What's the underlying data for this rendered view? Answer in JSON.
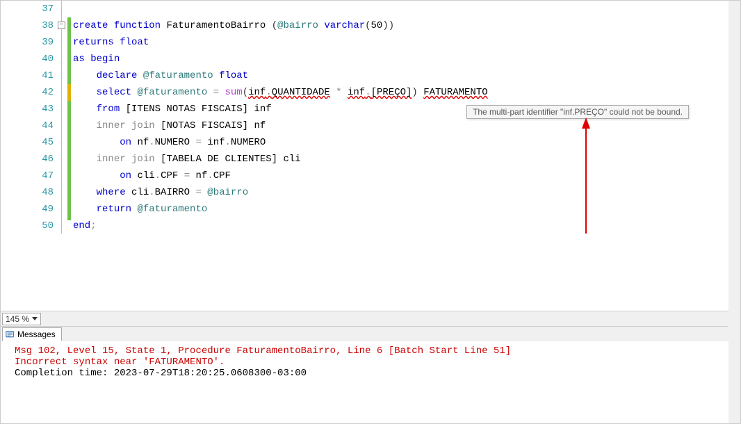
{
  "line_numbers": [
    "37",
    "38",
    "39",
    "40",
    "41",
    "42",
    "43",
    "44",
    "45",
    "46",
    "47",
    "48",
    "49",
    "50"
  ],
  "code": {
    "l38": {
      "w0": "create",
      "w1": "function",
      "w2": "FaturamentoBairro",
      "w3": "@bairro",
      "w4": "varchar",
      "w5": "50"
    },
    "l39": {
      "w0": "returns",
      "w1": "float"
    },
    "l40": {
      "w0": "as",
      "w1": "begin"
    },
    "l41": {
      "w0": "declare",
      "w1": "@faturamento",
      "w2": "float"
    },
    "l42": {
      "w0": "select",
      "w1": "@faturamento",
      "w2": "=",
      "w3": "sum",
      "w4": "inf",
      "w5": "QUANTIDADE",
      "w6": "*",
      "w7": "inf",
      "w8": "[PREÇO]",
      "w9": "FATURAMENTO"
    },
    "l43": {
      "w0": "from",
      "w1": "[ITENS NOTAS FISCAIS]",
      "w2": "inf"
    },
    "l44": {
      "w0": "inner",
      "w1": "join",
      "w2": "[NOTAS FISCAIS]",
      "w3": "nf"
    },
    "l45": {
      "w0": "on",
      "w1": "nf",
      "w2": "NUMERO",
      "w3": "=",
      "w4": "inf",
      "w5": "NUMERO"
    },
    "l46": {
      "w0": "inner",
      "w1": "join",
      "w2": "[TABELA DE CLIENTES]",
      "w3": "cli"
    },
    "l47": {
      "w0": "on",
      "w1": "cli",
      "w2": "CPF",
      "w3": "=",
      "w4": "nf",
      "w5": "CPF"
    },
    "l48": {
      "w0": "where",
      "w1": "cli",
      "w2": "BAIRRO",
      "w3": "=",
      "w4": "@bairro"
    },
    "l49": {
      "w0": "return",
      "w1": "@faturamento"
    },
    "l50": {
      "w0": "end",
      "w1": ";"
    }
  },
  "tooltip": {
    "text": "The multi-part identifier \"inf.PREÇO\" could not be bound."
  },
  "zoom": {
    "level": "145 %"
  },
  "tab": {
    "label": "Messages"
  },
  "messages": {
    "line1": "Msg 102, Level 15, State 1, Procedure FaturamentoBairro, Line 6 [Batch Start Line 51]",
    "line2": "Incorrect syntax near 'FATURAMENTO'.",
    "blank": "",
    "line3": "Completion time: 2023-07-29T18:20:25.0608300-03:00"
  },
  "fold": {
    "glyph": "−"
  }
}
